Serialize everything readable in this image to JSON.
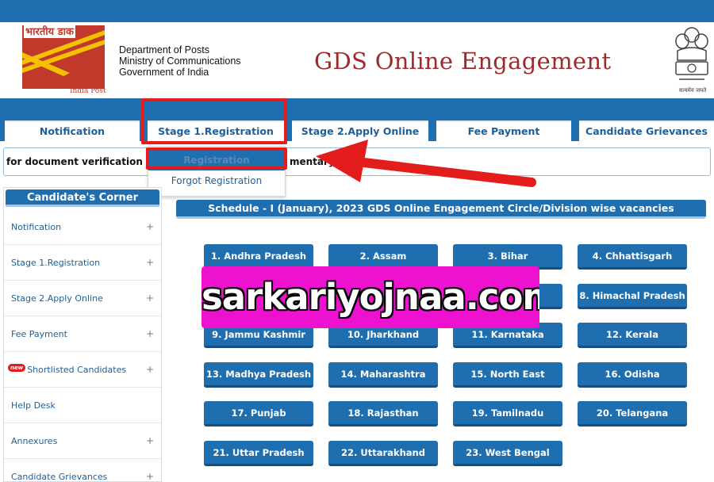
{
  "header": {
    "logo_hindi": "भारतीय डाक",
    "logo_caption": "India Post",
    "dept_lines": [
      "Department of Posts",
      "Ministry of Communications",
      "Government of India"
    ],
    "site_title": "GDS Online Engagement",
    "emblem_caption": "सत्यमेव जयते"
  },
  "nav": {
    "tabs": [
      {
        "label": "Notification"
      },
      {
        "label": "Stage 1.Registration"
      },
      {
        "label": "Stage 2.Apply Online"
      },
      {
        "label": "Fee Payment"
      },
      {
        "label": "Candidate Grievances"
      }
    ],
    "dropdown": [
      "Registration",
      "Forgot Registration"
    ]
  },
  "marquee": {
    "text_left": "for document verification is re",
    "text_right": "mentary L"
  },
  "sidebar": {
    "title": "Candidate's Corner",
    "new_badge": "new",
    "items": [
      {
        "label": "Notification",
        "plus": "+"
      },
      {
        "label": "Stage 1.Registration",
        "plus": "+"
      },
      {
        "label": "Stage 2.Apply Online",
        "plus": "+"
      },
      {
        "label": "Fee Payment",
        "plus": "+"
      },
      {
        "label": "Shortlisted Candidates",
        "plus": "+"
      },
      {
        "label": "Help Desk",
        "plus": ""
      },
      {
        "label": "Annexures",
        "plus": "+"
      },
      {
        "label": "Candidate Grievances",
        "plus": "+"
      }
    ]
  },
  "schedule_title": "Schedule - I (January), 2023 GDS Online Engagement Circle/Division wise vacancies",
  "states": [
    "1. Andhra Pradesh",
    "2. Assam",
    "3. Bihar",
    "4. Chhattisgarh",
    "",
    "",
    "",
    "8. Himachal Pradesh",
    "9. Jammu Kashmir",
    "10. Jharkhand",
    "11. Karnataka",
    "12. Kerala",
    "13. Madhya Pradesh",
    "14. Maharashtra",
    "15. North East",
    "16. Odisha",
    "17. Punjab",
    "18. Rajasthan",
    "19. Tamilnadu",
    "20. Telangana",
    "21. Uttar Pradesh",
    "22. Uttarakhand",
    "23. West Bengal"
  ],
  "watermark": "sarkariyojnaa.com",
  "colors": {
    "primary_blue": "#1f6fb0",
    "title_maroon": "#9c2b2b",
    "highlight_red": "#e31c1c",
    "watermark_magenta": "#ec12cf"
  }
}
